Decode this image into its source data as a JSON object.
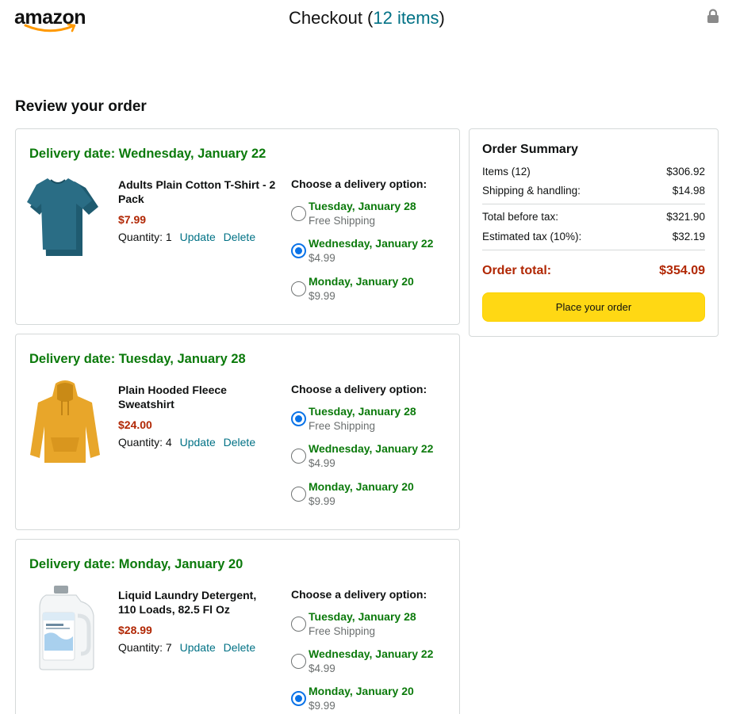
{
  "header": {
    "logo_text": "amazon",
    "title_prefix": "Checkout (",
    "title_items": "12 items",
    "title_suffix": ")"
  },
  "review_heading": "Review your order",
  "orders": [
    {
      "delivery_date": "Delivery date: Wednesday, January 22",
      "product": "Adults Plain Cotton T-Shirt - 2 Pack",
      "price": "$7.99",
      "quantity_label": "Quantity: 1",
      "update_label": "Update",
      "delete_label": "Delete",
      "choose_label": "Choose a delivery option:",
      "selected_option": 1,
      "options": [
        {
          "date": "Tuesday, January 28",
          "cost": "Free Shipping"
        },
        {
          "date": "Wednesday, January 22",
          "cost": "$4.99"
        },
        {
          "date": "Monday, January 20",
          "cost": "$9.99"
        }
      ]
    },
    {
      "delivery_date": "Delivery date: Tuesday, January 28",
      "product": "Plain Hooded Fleece Sweatshirt",
      "price": "$24.00",
      "quantity_label": "Quantity: 4",
      "update_label": "Update",
      "delete_label": "Delete",
      "choose_label": "Choose a delivery option:",
      "selected_option": 0,
      "options": [
        {
          "date": "Tuesday, January 28",
          "cost": "Free Shipping"
        },
        {
          "date": "Wednesday, January 22",
          "cost": "$4.99"
        },
        {
          "date": "Monday, January 20",
          "cost": "$9.99"
        }
      ]
    },
    {
      "delivery_date": "Delivery date: Monday, January 20",
      "product": "Liquid Laundry Detergent, 110 Loads, 82.5 Fl Oz",
      "price": "$28.99",
      "quantity_label": "Quantity: 7",
      "update_label": "Update",
      "delete_label": "Delete",
      "choose_label": "Choose a delivery option:",
      "selected_option": 2,
      "options": [
        {
          "date": "Tuesday, January 28",
          "cost": "Free Shipping"
        },
        {
          "date": "Wednesday, January 22",
          "cost": "$4.99"
        },
        {
          "date": "Monday, January 20",
          "cost": "$9.99"
        }
      ]
    }
  ],
  "summary": {
    "title": "Order Summary",
    "items_label": "Items (12)",
    "items_value": "$306.92",
    "shipping_label": "Shipping & handling:",
    "shipping_value": "$14.98",
    "before_tax_label": "Total before tax:",
    "before_tax_value": "$321.90",
    "tax_label": "Estimated tax (10%):",
    "tax_value": "$32.19",
    "total_label": "Order total:",
    "total_value": "$354.09",
    "button_label": "Place your order"
  },
  "colors": {
    "accent_link": "#007185",
    "delivery_green": "#0b7a0b",
    "price_red": "#b12704",
    "button_yellow": "#ffd814",
    "radio_blue": "#0a73e8"
  },
  "icons": [
    "amazon-logo",
    "lock-icon",
    "tshirt-image",
    "hoodie-image",
    "detergent-image"
  ]
}
